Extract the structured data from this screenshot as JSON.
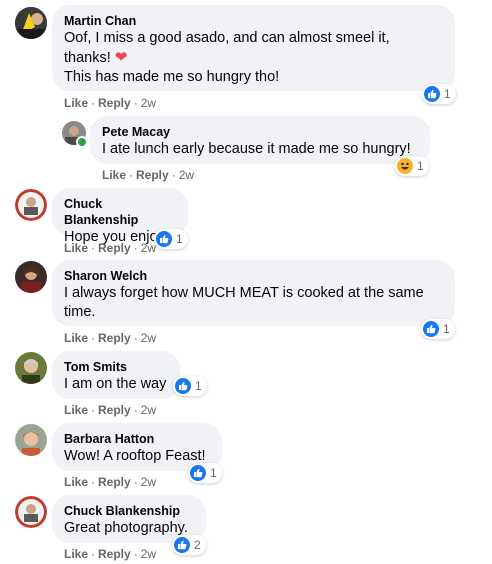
{
  "colors": {
    "bubble": "#f0f2f5",
    "meta": "#65676b",
    "like_blue": "#1877f2",
    "haha_yellow": "#f7b125",
    "heart_red": "#f33e58"
  },
  "actions": {
    "like": "Like",
    "reply": "Reply",
    "separator": "·"
  },
  "comments": [
    {
      "author": "Martin Chan",
      "lines": [
        "Oof, I miss a good asado, and can almost smeel it,",
        "thanks!",
        "This has made me so hungry tho!"
      ],
      "emoji": "❤",
      "time": "2w",
      "reaction_icon": "like-icon",
      "reaction_count": "1"
    },
    {
      "author": "Pete Macay",
      "lines": [
        "I ate lunch early because it made me so hungry!"
      ],
      "time": "2w",
      "reaction_icon": "haha-icon",
      "reaction_count": "1"
    },
    {
      "author": "Chuck Blankenship",
      "lines": [
        "Hope you enjoy"
      ],
      "time": "2w",
      "reaction_icon": "like-icon",
      "reaction_count": "1"
    },
    {
      "author": "Sharon Welch",
      "lines": [
        "I always forget how MUCH MEAT is cooked at the same",
        "time."
      ],
      "time": "2w",
      "reaction_icon": "like-icon",
      "reaction_count": "1"
    },
    {
      "author": "Tom Smits",
      "lines": [
        "I am on the way"
      ],
      "time": "2w",
      "reaction_icon": "like-icon",
      "reaction_count": "1"
    },
    {
      "author": "Barbara Hatton",
      "lines": [
        "Wow! A rooftop Feast!"
      ],
      "time": "2w",
      "reaction_icon": "like-icon",
      "reaction_count": "1"
    },
    {
      "author": "Chuck Blankenship",
      "lines": [
        "Great photography."
      ],
      "time": "2w",
      "reaction_icon": "like-icon",
      "reaction_count": "2"
    }
  ]
}
